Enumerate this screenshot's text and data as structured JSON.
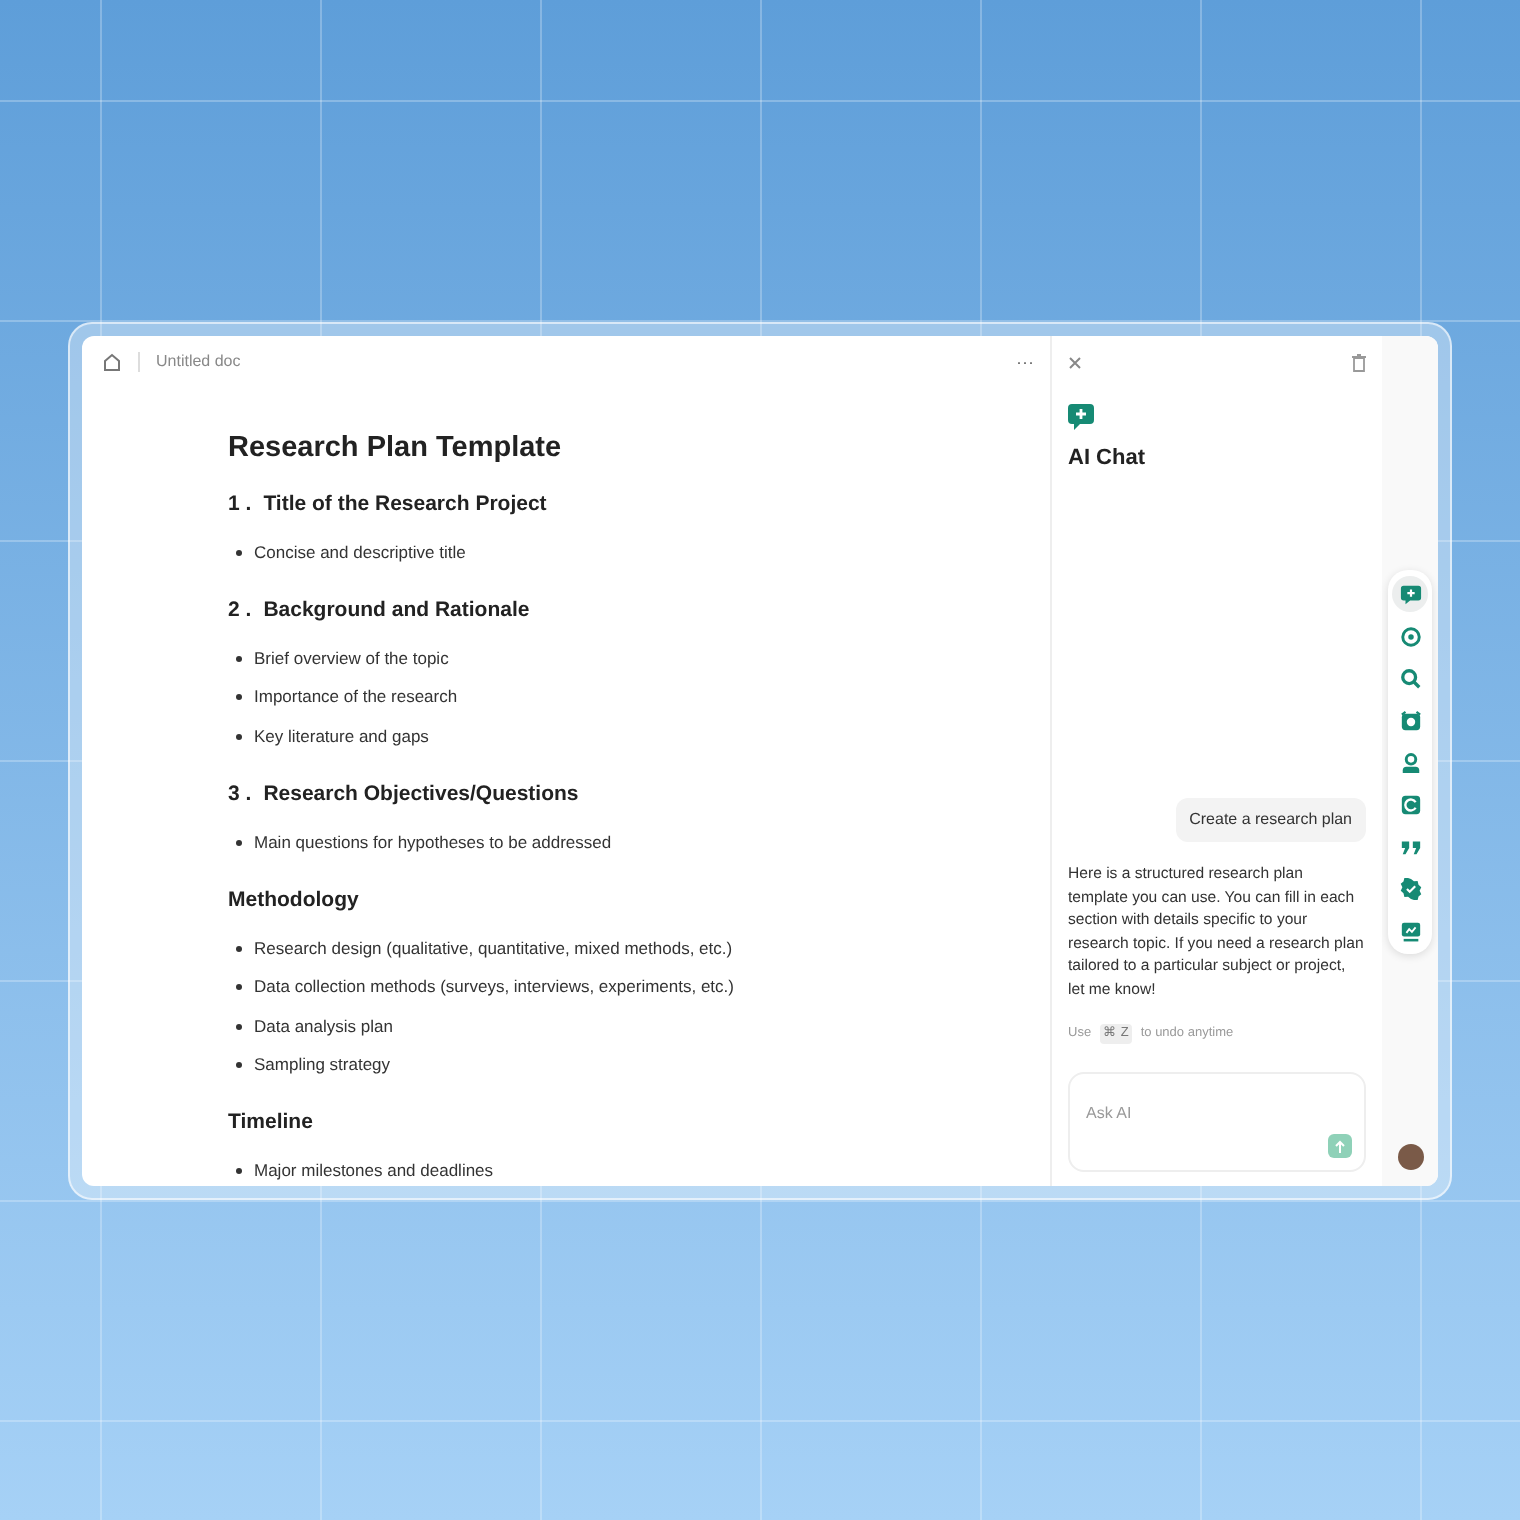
{
  "header": {
    "doc_title": "Untitled doc",
    "more": "···"
  },
  "document": {
    "title": "Research Plan Template",
    "blocks": [
      {
        "kind": "heading",
        "number": "1 .",
        "text": "Title of the Research Project"
      },
      {
        "kind": "bullet",
        "text": "Concise and descriptive title"
      },
      {
        "kind": "heading",
        "number": "2 .",
        "text": "Background and Rationale"
      },
      {
        "kind": "bullet",
        "text": "Brief overview of the topic"
      },
      {
        "kind": "bullet",
        "text": "Importance of the research"
      },
      {
        "kind": "bullet",
        "text": "Key literature and gaps"
      },
      {
        "kind": "heading",
        "number": "3 .",
        "text": "Research Objectives/Questions"
      },
      {
        "kind": "bullet",
        "text": "Main questions for hypotheses to be addressed"
      },
      {
        "kind": "heading",
        "text": "Methodology"
      },
      {
        "kind": "bullet",
        "text": "Research design (qualitative, quantitative, mixed methods, etc.)"
      },
      {
        "kind": "bullet",
        "text": "Data collection methods (surveys, interviews, experiments, etc.)"
      },
      {
        "kind": "bullet",
        "text": "Data analysis plan"
      },
      {
        "kind": "bullet",
        "text": "Sampling strategy"
      },
      {
        "kind": "heading",
        "text": "Timeline"
      },
      {
        "kind": "bullet",
        "text": "Major milestones and deadlines"
      }
    ]
  },
  "chat": {
    "title": "AI Chat",
    "messages": [
      {
        "kind": "user",
        "text": "Create a research plan"
      },
      {
        "kind": "assistant",
        "text": "Here is a structured research plan template you can use. You can fill in each section with details specific to your research topic. If you need a research plan tailored to a particular subject or project, let me know!"
      }
    ],
    "undo_hint": {
      "before": "Use",
      "key": "⌘ Z",
      "after": "to undo anytime"
    },
    "input": {
      "placeholder": "Ask AI"
    }
  },
  "rail": [
    {
      "selected": true
    },
    {
      "selected": false
    },
    {
      "selected": false
    },
    {
      "selected": false
    },
    {
      "selected": false
    },
    {
      "selected": false
    },
    {
      "selected": false
    },
    {
      "selected": false
    },
    {
      "selected": false
    }
  ]
}
